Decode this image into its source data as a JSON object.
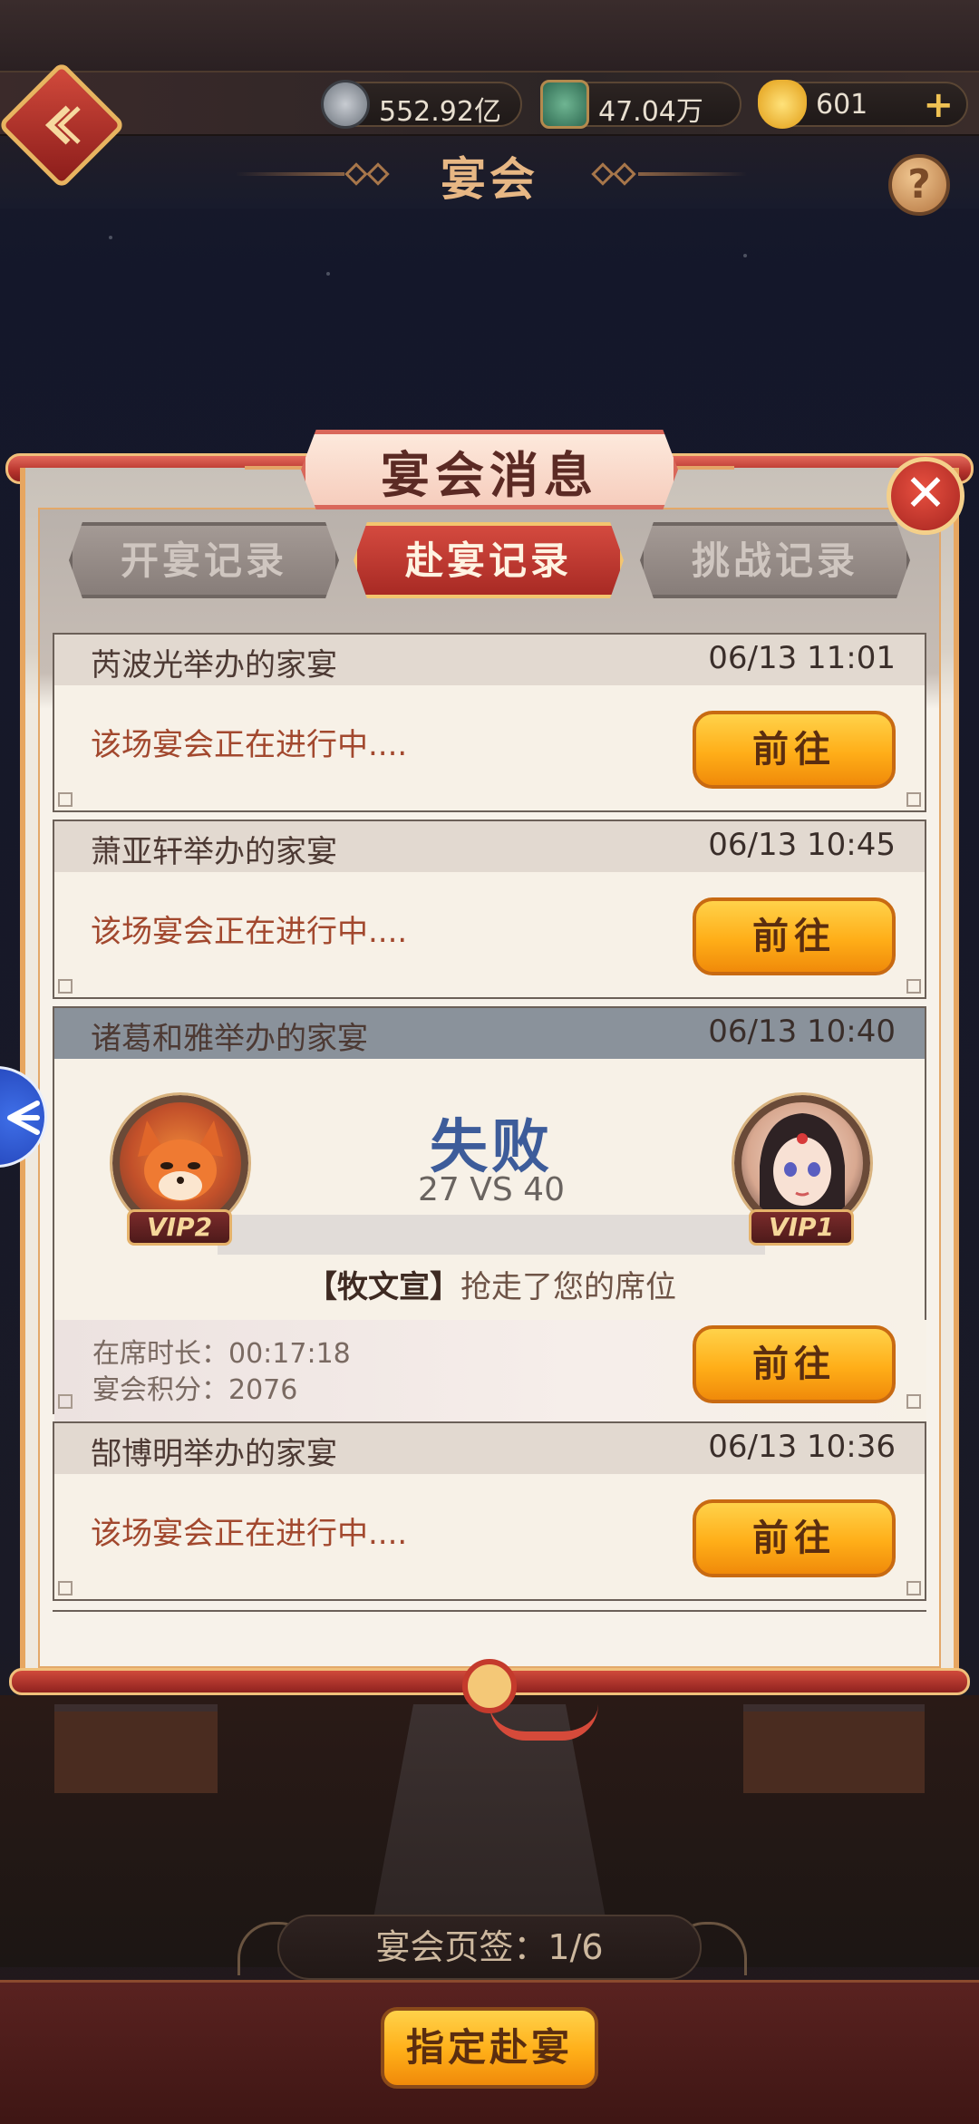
{
  "topbar": {
    "resources": [
      {
        "icon": "silver-coin-icon",
        "value": "552.92亿"
      },
      {
        "icon": "jade-token-icon",
        "value": "47.04万"
      },
      {
        "icon": "gold-ingot-icon",
        "value": "601"
      }
    ],
    "title": "宴会",
    "help_label": "?"
  },
  "panel": {
    "title": "宴会消息",
    "tabs": [
      "开宴记录",
      "赴宴记录",
      "挑战记录"
    ],
    "active_tab": 1,
    "close_label": "✕"
  },
  "entries": [
    {
      "host": "芮波光举办的家宴",
      "time": "06/13 11:01",
      "status": "该场宴会正在进行中....",
      "button": "前往"
    },
    {
      "host": "萧亚轩举办的家宴",
      "time": "06/13 10:45",
      "status": "该场宴会正在进行中....",
      "button": "前往"
    },
    {
      "host": "诸葛和雅举办的家宴",
      "time": "06/13 10:40",
      "result": "失败",
      "score": "27 VS 40",
      "left_vip": "VIP2",
      "right_vip": "VIP1",
      "grabbed_name": "【牧文宣】",
      "grabbed_text": "抢走了您的席位",
      "duration_label": "在席时长：",
      "duration": "00:17:18",
      "points_label": "宴会积分：",
      "points": "2076",
      "button": "前往"
    },
    {
      "host": "郜博明举办的家宴",
      "time": "06/13 10:36",
      "status": "该场宴会正在进行中....",
      "button": "前往"
    }
  ],
  "footer": {
    "page_tag": "宴会页签：1/6",
    "assign_button": "指定赴宴"
  },
  "colors": {
    "accent_red": "#b7332c",
    "button_gold": "#ffae18",
    "lose_blue": "#3d5c9a",
    "status_text": "#a2482e"
  }
}
